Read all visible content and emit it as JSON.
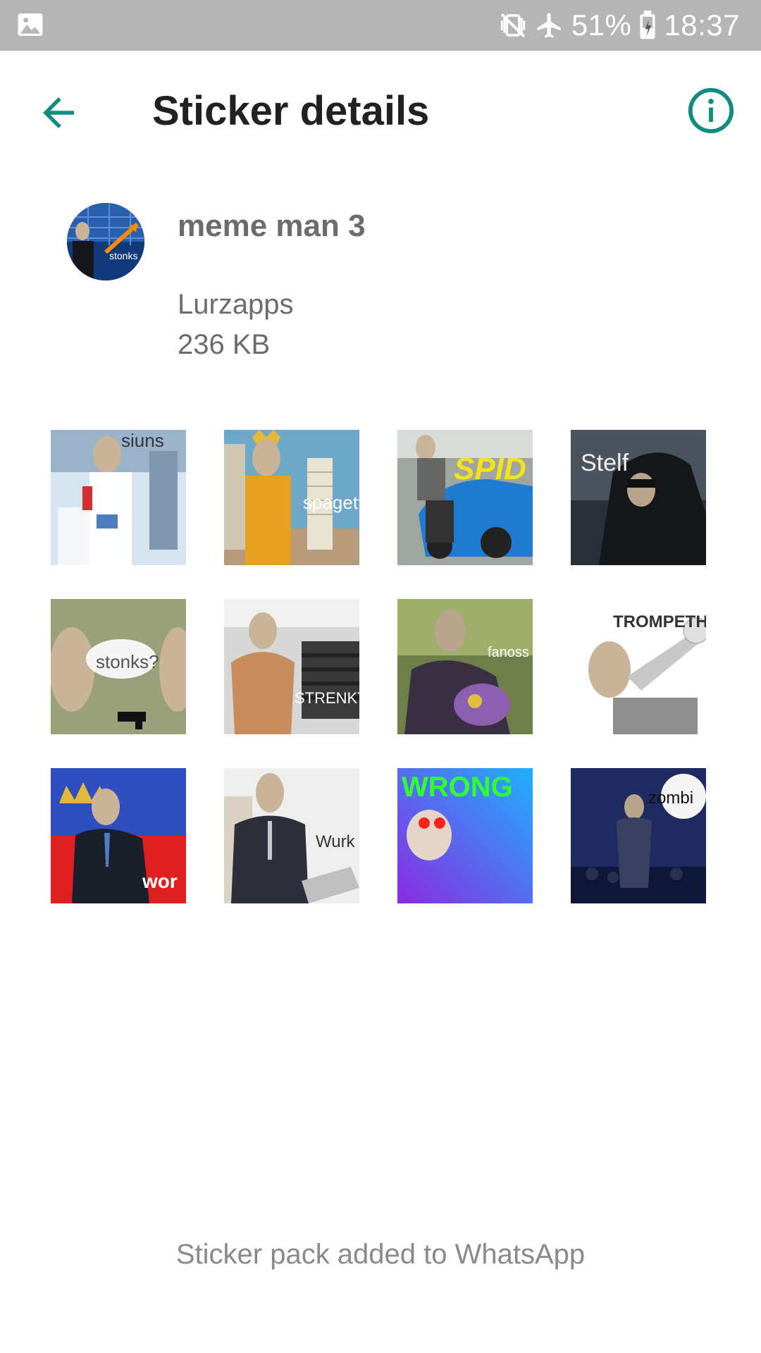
{
  "status_bar": {
    "battery": "51%",
    "time": "18:37",
    "icons": [
      "gallery-icon",
      "vibrate-mute-icon",
      "airplane-mode-icon",
      "battery-charging-icon"
    ]
  },
  "app_bar": {
    "title": "Sticker details",
    "icons": [
      "back-arrow-icon",
      "info-icon"
    ]
  },
  "pack": {
    "name": "meme man 3",
    "publisher": "Lurzapps",
    "size": "236 KB",
    "tray_caption": "stonks"
  },
  "stickers": [
    {
      "caption": "siuns"
    },
    {
      "caption": "spagett"
    },
    {
      "caption": "SPID"
    },
    {
      "caption": "Stelf"
    },
    {
      "caption": "stonks?"
    },
    {
      "caption": "STRENKT"
    },
    {
      "caption": "fanoss"
    },
    {
      "caption": "TROMPETH"
    },
    {
      "caption": "wor"
    },
    {
      "caption": "Wurk"
    },
    {
      "caption": "WRONG"
    },
    {
      "caption": "zombi"
    }
  ],
  "footer": {
    "status": "Sticker pack added to WhatsApp"
  },
  "colors": {
    "accent": "#128C7E",
    "status_bar": "#b5b5b5",
    "secondary_text": "#6c6c6c"
  }
}
